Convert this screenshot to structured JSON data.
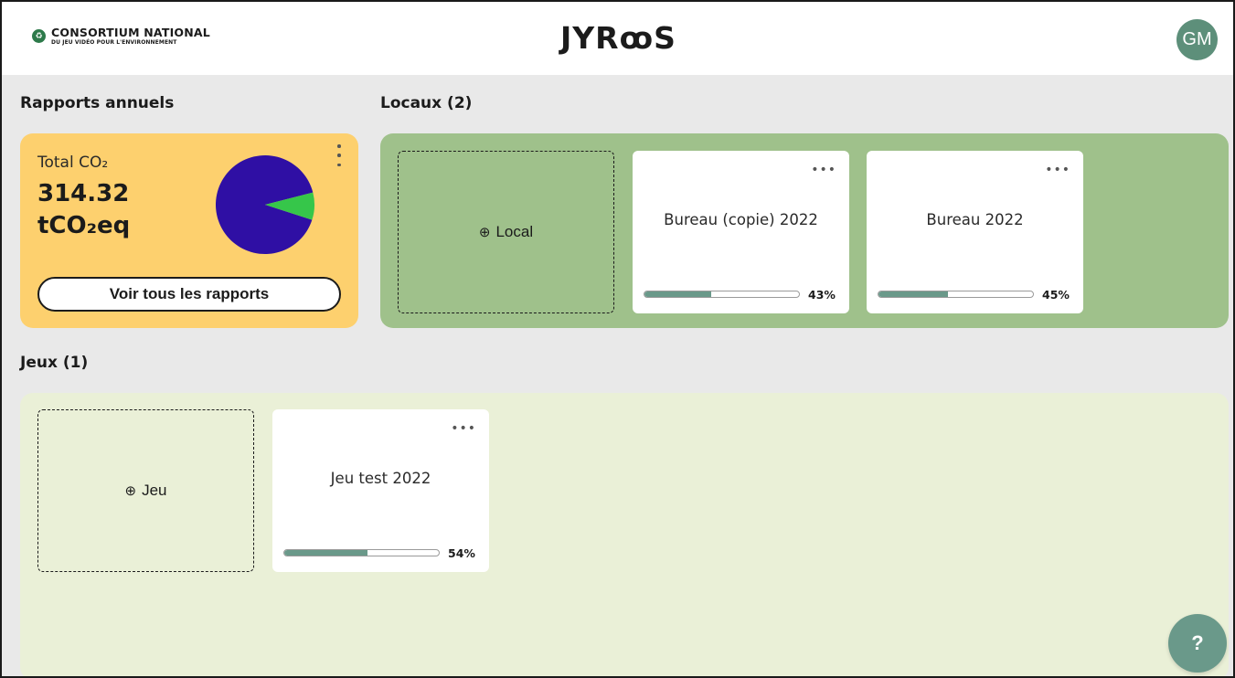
{
  "header": {
    "consortium_line1": "CONSORTIUM NATIONAL",
    "consortium_line2": "DU JEU VIDÉO POUR L'ENVIRONNEMENT",
    "logo_text": "JYRꝏS",
    "avatar_initials": "GM"
  },
  "rapports": {
    "section_title": "Rapports annuels",
    "total_label": "Total CO₂",
    "total_value": "314.32",
    "total_unit": "tCO₂eq",
    "button_label": "Voir tous les rapports",
    "pie": {
      "slices": [
        {
          "name": "",
          "fraction": 0.91,
          "color": "#2f0fa4"
        },
        {
          "name": "",
          "fraction": 0.09,
          "color": "#36c64a"
        }
      ]
    }
  },
  "locaux": {
    "section_title": "Locaux (2)",
    "add_label": "Local",
    "items": [
      {
        "name": "Bureau (copie) 2022",
        "progress": 43,
        "progress_label": "43%"
      },
      {
        "name": "Bureau 2022",
        "progress": 45,
        "progress_label": "45%"
      }
    ]
  },
  "jeux": {
    "section_title": "Jeux (1)",
    "add_label": "Jeu",
    "items": [
      {
        "name": "Jeu test 2022",
        "progress": 54,
        "progress_label": "54%"
      }
    ]
  },
  "help": {
    "label": "?"
  },
  "colors": {
    "report_card": "#fdd06e",
    "locaux_panel": "#9fc18b",
    "jeux_panel": "#eaf0d7",
    "progress_fill": "#6a998a",
    "avatar": "#5d8f7a"
  },
  "icons": {
    "add": "plus-circle-icon",
    "menu_vertical": "kebab-vertical-icon",
    "menu_horizontal": "ellipsis-horizontal-icon",
    "consortium_logo": "leaf-icon"
  }
}
